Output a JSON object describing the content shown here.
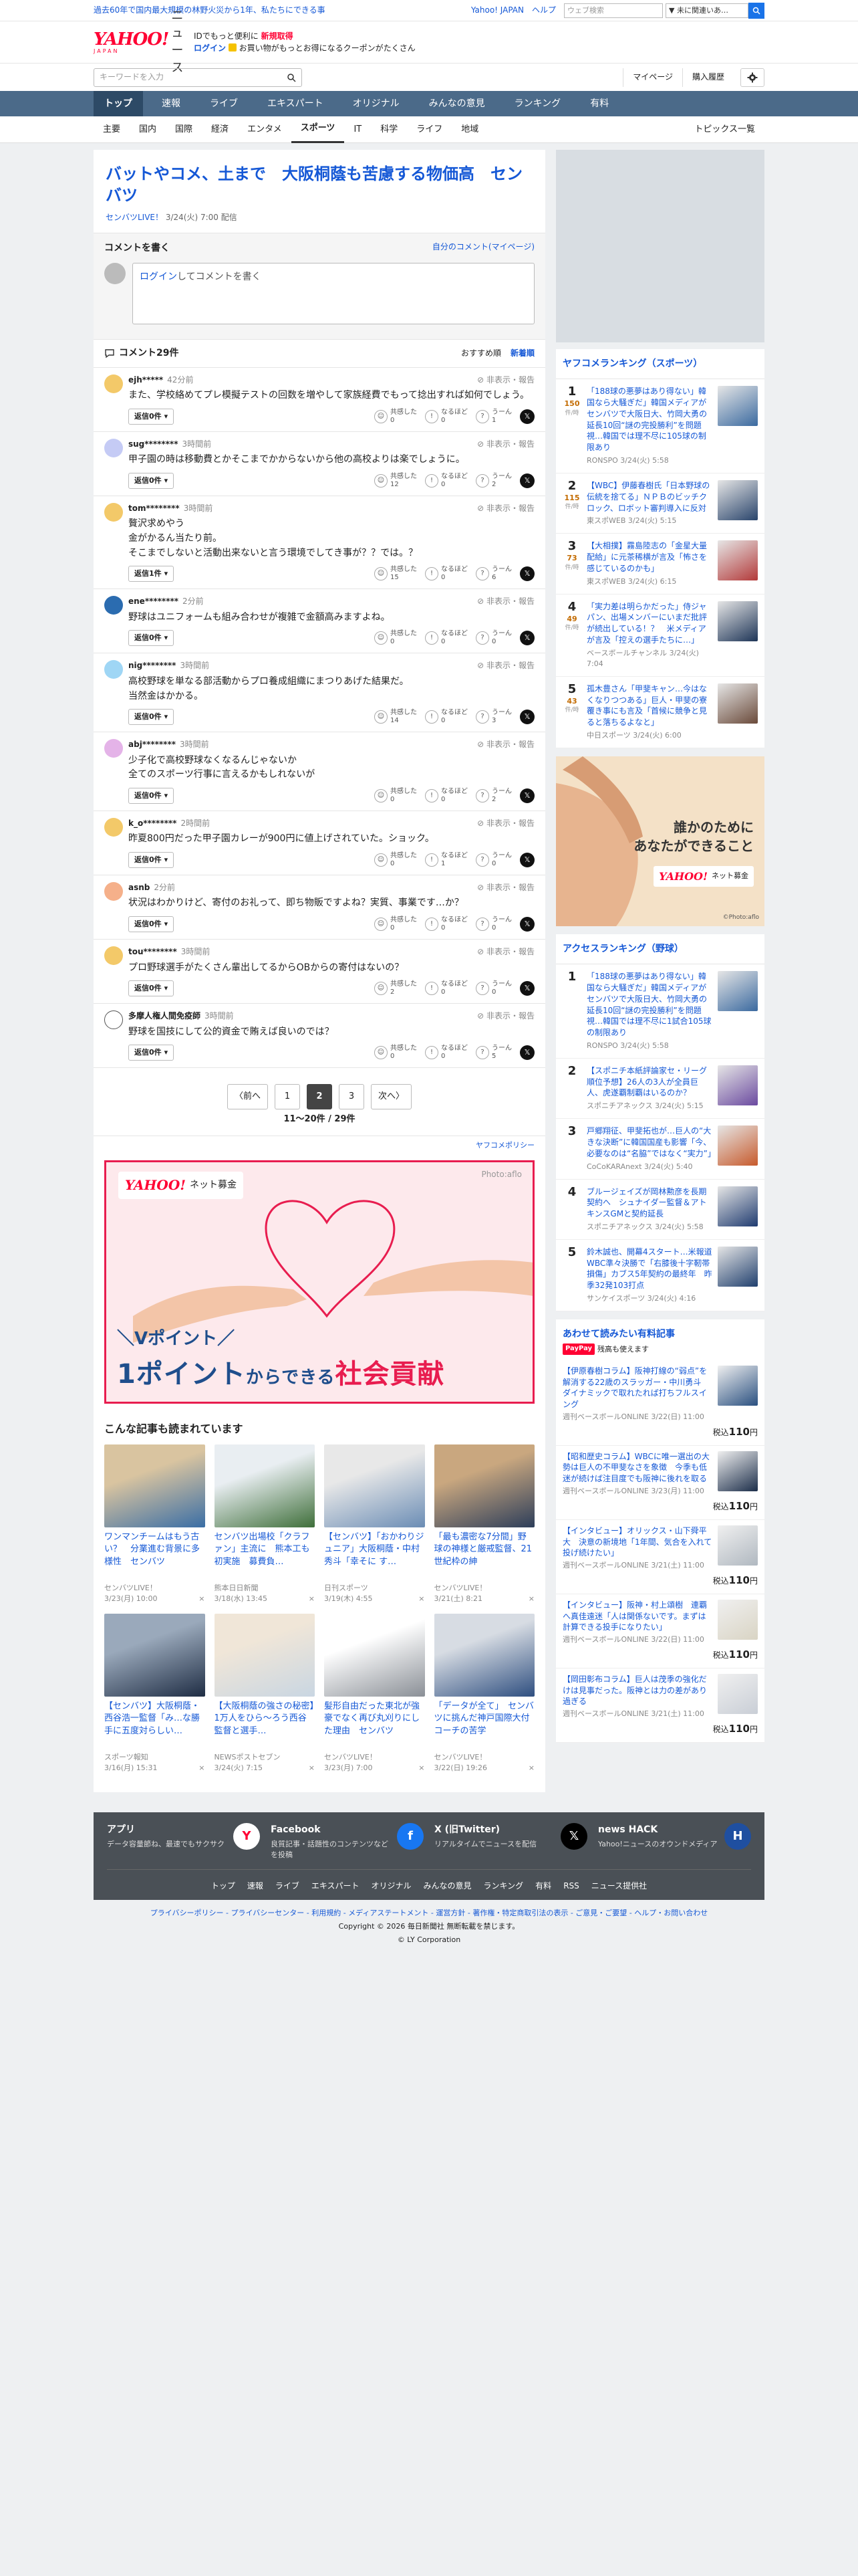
{
  "topbar": {
    "news": "過去60年で国内最大規模の林野火災から1年、私たちにできる事",
    "yj": "Yahoo! JAPAN",
    "help": "ヘルプ",
    "search_placeholder": "ウェブ検索",
    "select": "▼ 未に関連いあ…"
  },
  "header": {
    "logo": "YAHOO!",
    "logo_sub": "JAPAN",
    "logo_news": "ニュース",
    "msg1a": "IDでもっと便利に",
    "msg1b": "新規取得",
    "msg2a": "ログイン",
    "msg2b": "お買い物がもっとお得になるクーポンがたくさん"
  },
  "search": {
    "placeholder": "キーワードを入力",
    "mypage": "マイページ",
    "purchased": "購入履歴"
  },
  "nav_main": [
    "トップ",
    "速報",
    "ライブ",
    "エキスパート",
    "オリジナル",
    "みんなの意見",
    "ランキング",
    "有料"
  ],
  "nav_sub": [
    "主要",
    "国内",
    "国際",
    "経済",
    "エンタメ",
    "スポーツ",
    "IT",
    "科学",
    "ライフ",
    "地域"
  ],
  "nav_topics": "トピックス一覧",
  "article": {
    "title": "バットやコメ、土まで　大阪桐蔭も苦慮する物価高　センバツ",
    "source": "センバツLIVE！",
    "date": "3/24(火) 7:00 配信"
  },
  "comment_write": {
    "title": "コメントを書く",
    "mine": "自分のコメント(マイページ)",
    "login": "ログイン",
    "prompt": "してコメントを書く"
  },
  "comments_head": {
    "count": "コメント29件",
    "recommended": "おすすめ順",
    "newest": "新着順"
  },
  "labels": {
    "report": "非表示・報告",
    "reply": "返信",
    "agree": "共感した",
    "naruhodo": "なるほど",
    "umm": "うーん"
  },
  "comments": [
    {
      "user": "ejh*****",
      "time": "42分前",
      "text": "また、学校絡めてプレ模擬テストの回数を増やして家族経費でもって捻出すれば如何でしょう。",
      "replies": "返信0件",
      "agree": "0",
      "naruhodo": "0",
      "umm": "1",
      "color": "#f3c969"
    },
    {
      "user": "sug********",
      "time": "3時間前",
      "text": "甲子園の時は移動費とかそこまでかからないから他の高校よりは楽でしょうに。",
      "replies": "返信0件",
      "agree": "12",
      "naruhodo": "0",
      "umm": "2",
      "color": "#c5cbf5"
    },
    {
      "user": "tom********",
      "time": "3時間前",
      "text": "贅沢求めやう\n金がかるん当たり前。\nそこまでしないと活動出来ないと言う環境でしてき事が？？では。？",
      "replies": "返信1件",
      "agree": "15",
      "naruhodo": "0",
      "umm": "6",
      "color": "#f3c969"
    },
    {
      "user": "ene********",
      "time": "2分前",
      "text": "野球はユニフォームも組み合わせが複雑で金額高みますよね。",
      "replies": "返信0件",
      "agree": "0",
      "naruhodo": "0",
      "umm": "0",
      "color": "#2b6cb0"
    },
    {
      "user": "nig********",
      "time": "3時間前",
      "text": "高校野球を単なる部活動からプロ養成組織にまつりあげた結果だ。\n当然金はかかる。",
      "replies": "返信0件",
      "agree": "14",
      "naruhodo": "0",
      "umm": "3",
      "color": "#9fd6f5"
    },
    {
      "user": "abj********",
      "time": "3時間前",
      "text": "少子化で高校野球なくなるんじゃないか\n全てのスポーツ行事に言えるかもしれないが",
      "replies": "返信0件",
      "agree": "0",
      "naruhodo": "0",
      "umm": "2",
      "color": "#e4b3e8"
    },
    {
      "user": "k_o********",
      "time": "2時間前",
      "text": "昨夏800円だった甲子園カレーが900円に値上げされていた。ショック。",
      "replies": "返信0件",
      "agree": "0",
      "naruhodo": "1",
      "umm": "0",
      "color": "#f3c969"
    },
    {
      "user": "asnb",
      "time": "2分前",
      "text": "状況はわかりけど、寄付のお礼って、即ち物販ですよね？実質、事業です…か？",
      "replies": "返信0件",
      "agree": "0",
      "naruhodo": "0",
      "umm": "0",
      "color": "#f5b08a"
    },
    {
      "user": "tou********",
      "time": "3時間前",
      "text": "プロ野球選手がたくさん輩出してるからOBからの寄付はないの？",
      "replies": "返信0件",
      "agree": "2",
      "naruhodo": "0",
      "umm": "0",
      "color": "#f3c969"
    },
    {
      "user": "多摩人権人間免疫師",
      "time": "3時間前",
      "text": "野球を国技にして公的資金で賄えば良いのでは？",
      "replies": "返信0件",
      "agree": "0",
      "naruhodo": "0",
      "umm": "5",
      "color": "#ffffff"
    }
  ],
  "pager": {
    "prev": "〈前へ",
    "pages": [
      "1",
      "2",
      "3"
    ],
    "next": "次へ〉",
    "info": "11〜20件 / 29件"
  },
  "policy": "ヤフコメポリシー",
  "ad_main": {
    "logo": "YAHOO!",
    "logo_sub": "ネット募金",
    "photo": "Photo:aflo",
    "line1": "＼Vポイント／",
    "line2a": "1ポイント",
    "line2b": "からできる",
    "line2c": "社会貢献"
  },
  "related": {
    "title": "こんな記事も読まれています",
    "items": [
      {
        "title": "ワンマンチームはもう古い？　分業進む背景に多様性　センバツ",
        "src": "センバツLIVE！",
        "time": "3/23(月) 10:00",
        "c1": "#3a6ea5",
        "c2": "#d9c4a0"
      },
      {
        "title": "センバツ出場校「クラファン」主流に　熊本工も初実施　募費負…",
        "src": "熊本日日新聞",
        "time": "3/18(水) 13:45",
        "c1": "#3f6f3a",
        "c2": "#e9eef2"
      },
      {
        "title": "【センバツ】「おかわりジュニア」大阪桐蔭・中村秀斗「幸そに す…",
        "src": "日刊スポーツ",
        "time": "3/19(木) 4:55",
        "c1": "#6b8db5",
        "c2": "#e8e8e8"
      },
      {
        "title": "「最も濃密な7分間」野球の神様と厳戒監督、21世紀枠の紳",
        "src": "センバツLIVE！",
        "time": "3/21(土) 8:21",
        "c1": "#2d3e5a",
        "c2": "#c9a77f"
      },
      {
        "title": "【センバツ】大阪桐蔭・西谷浩一監督「み…な勝手に五度対らしい…",
        "src": "スポーツ報知",
        "time": "3/16(月) 15:31",
        "c1": "#1f2d44",
        "c2": "#9aa9bb"
      },
      {
        "title": "【大阪桐蔭の強さの秘密】1万人をひら〜ろう西谷監督と選手…",
        "src": "NEWSポストセブン",
        "time": "3/24(火) 7:15",
        "c1": "#c9d6e2",
        "c2": "#f0e6d8"
      },
      {
        "title": "髪形自由だった東北が強豪でなく再び丸刈りにした理由　センバツ",
        "src": "センバツLIVE！",
        "time": "3/23(月) 7:00",
        "c1": "#8a8f96",
        "c2": "#ffffff"
      },
      {
        "title": "「データが全て」　センバツに挑んだ神戸国際大付コーチの苦学",
        "src": "センバツLIVE！",
        "time": "3/22(日) 19:26",
        "c1": "#2f4f80",
        "c2": "#d7dce3"
      }
    ]
  },
  "sidebar": {
    "rank_sports_title": "ヤフコメランキング（スポーツ）",
    "rank_unit": "件/時",
    "rank_sports": [
      {
        "n": "1",
        "c": "150",
        "title": "「188球の悪夢はあり得ない」韓国なら大騒ぎだ」韓国メディアがセンバツで大阪日大、竹岡大勇の延長10回“謎の完投勝利”を問題視…韓国では理不尽に105球の制限あり",
        "src": "RONSPO 3/24(火) 5:58",
        "c1": "#3b6aa0"
      },
      {
        "n": "2",
        "c": "115",
        "title": "【WBC】伊藤春樹氏「日本野球の伝統を捨てる」ＮＰＢのビッチクロック、ロボット審判導入に反対",
        "src": "東スポWEB 3/24(火) 5:15",
        "c1": "#29446b"
      },
      {
        "n": "3",
        "c": "73",
        "title": "【大相撲】霧島陸志の「金星大量配給」に元茶稀横が言及「怖さを感じているのかも」",
        "src": "東スポWEB 3/24(火) 6:15",
        "c1": "#b33939"
      },
      {
        "n": "4",
        "c": "49",
        "title": "「実力差は明らかだった」侍ジャパン、出場メンバーにいまだ批評が続出している！？　米メディアが言及「控えの選手たちに…」",
        "src": "ベースボールチャンネル 3/24(火) 7:04",
        "c1": "#1e3557"
      },
      {
        "n": "5",
        "c": "43",
        "title": "孤木豊さん「甲斐キャン…今はなくなりつつある」巨人・甲斐の寮覆き事にも言及「首候に競争と見ると落ちるよなと」",
        "src": "中日スポーツ 3/24(火) 6:00",
        "c1": "#6a4a3a"
      }
    ],
    "ad2": {
      "line1": "誰かのために",
      "line2": "あなたができること",
      "logo": "YAHOO!",
      "logo_sub": "ネット募金",
      "photo": "©Photo:aflo"
    },
    "rank_base_title": "アクセスランキング（野球）",
    "rank_base": [
      {
        "n": "1",
        "title": "「188球の悪夢はあり得ない」韓国なら大騒ぎだ」韓国メディアがセンバツで大阪日大、竹岡大勇の延長10回“謎の完投勝利”を問題視…韓国では理不尽に1試合105球の制限あり",
        "src": "RONSPO 3/24(火) 5:58",
        "c1": "#3b6aa0"
      },
      {
        "n": "2",
        "title": "【スポニチ本紙評論家セ・リーグ順位予想】26人の3人が全員巨人、虎遂覇制覇はいるのか？",
        "src": "スポニチアネックス 3/24(火) 5:15",
        "c1": "#6b4aa0"
      },
      {
        "n": "3",
        "title": "戸郷翔征、甲斐拓也が…巨人の“大きな決断”に韓国国産も影響「今、必要なのは“名脇”ではなく“実力”」",
        "src": "CoCoKARAnext 3/24(火) 5:40",
        "c1": "#c75a2c"
      },
      {
        "n": "4",
        "title": "ブルージェイズが岡林勲彦を長期契約へ　シュナイダー監督＆アトキンスGMと契約延長",
        "src": "スポニチアネックス 3/24(火) 5:58",
        "c1": "#1f3b70"
      },
      {
        "n": "5",
        "title": "鈴木誠也、開幕4スタート…米報道　WBC準々決勝で「右膝後十字靭帯損傷」カブス5年契約の最終年　昨季32発103打点",
        "src": "サンケイスポーツ 3/24(火) 4:16",
        "c1": "#21406e"
      }
    ],
    "paid_title": "あわせて読みたい有料記事",
    "paid_sub_badge": "PayPay",
    "paid_sub": "残高も使えます",
    "paid": [
      {
        "title": "【伊原春樹コラム】阪神打線の“弱点”を解消する22歳のスラッガー・中川勇斗　ダイナミックで取れたれば打ちフルスイング",
        "src": "週刊ベースボールONLINE 3/22(日) 11:00",
        "price": "110",
        "c1": "#2a5080"
      },
      {
        "title": "【昭和歴史コラム】WBCに唯一選出の大勢は巨人の不甲斐なさを象徴　今季も低迷が続けば注目度でも阪神に後れを取る",
        "src": "週刊ベースボールONLINE 3/23(月) 11:00",
        "price": "110",
        "c1": "#1c2e4a"
      },
      {
        "title": "【インタビュー】オリックス・山下舜平大　決意の新境地「1年間、気合を入れて投げ続けたい」",
        "src": "週刊ベースボールONLINE 3/21(土) 11:00",
        "price": "110",
        "c1": "#b0b8c0"
      },
      {
        "title": "【インタビュー】阪神・村上頌樹　連覇へ真佳遠迷「人は関係ないです。まずは計算できる投手になりたい」",
        "src": "週刊ベースボールONLINE 3/22(日) 11:00",
        "price": "110",
        "c1": "#d9d4c4"
      },
      {
        "title": "【岡田彰布コラム】巨人は茂季の強化だけは見事だった。阪神とは力の差があり過ぎる",
        "src": "週刊ベースボールONLINE 3/21(土) 11:00",
        "price": "110",
        "c1": "#c9ced6"
      }
    ],
    "paid_price_prefix": "税込"
  },
  "footer": {
    "cols": [
      {
        "h": "アプリ",
        "d": "データ容量節ね、最速でもサクサク",
        "icon": "Y",
        "icon_bg": "#ffffff",
        "icon_fg": "#ff0033"
      },
      {
        "h": "Facebook",
        "d": "良質記事・話題性のコンテンツなどを投稿",
        "icon": "f",
        "icon_bg": "#1877f2",
        "icon_fg": "#ffffff"
      },
      {
        "h": "X (旧Twitter)",
        "d": "リアルタイムでニュースを配信",
        "icon": "𝕏",
        "icon_bg": "#000000",
        "icon_fg": "#ffffff"
      },
      {
        "h": "news HACK",
        "d": "Yahoo!ニュースのオウンドメディア",
        "icon": "H",
        "icon_bg": "#1f4fa0",
        "icon_fg": "#ffffff"
      }
    ],
    "nav": [
      "トップ",
      "速報",
      "ライブ",
      "エキスパート",
      "オリジナル",
      "みんなの意見",
      "ランキング",
      "有料",
      "RSS",
      "ニュース提供社"
    ],
    "links": "プライバシーポリシー - プライバシーセンター - 利用規約 - メディアステートメント - 運営方針 - 著作権・特定商取引法の表示 - ご意見・ご要望 - ヘルプ・お問い合わせ",
    "copyright": "Copyright © 2026 毎日新聞社 無断転載を禁じます。",
    "corp": "© LY Corporation"
  }
}
